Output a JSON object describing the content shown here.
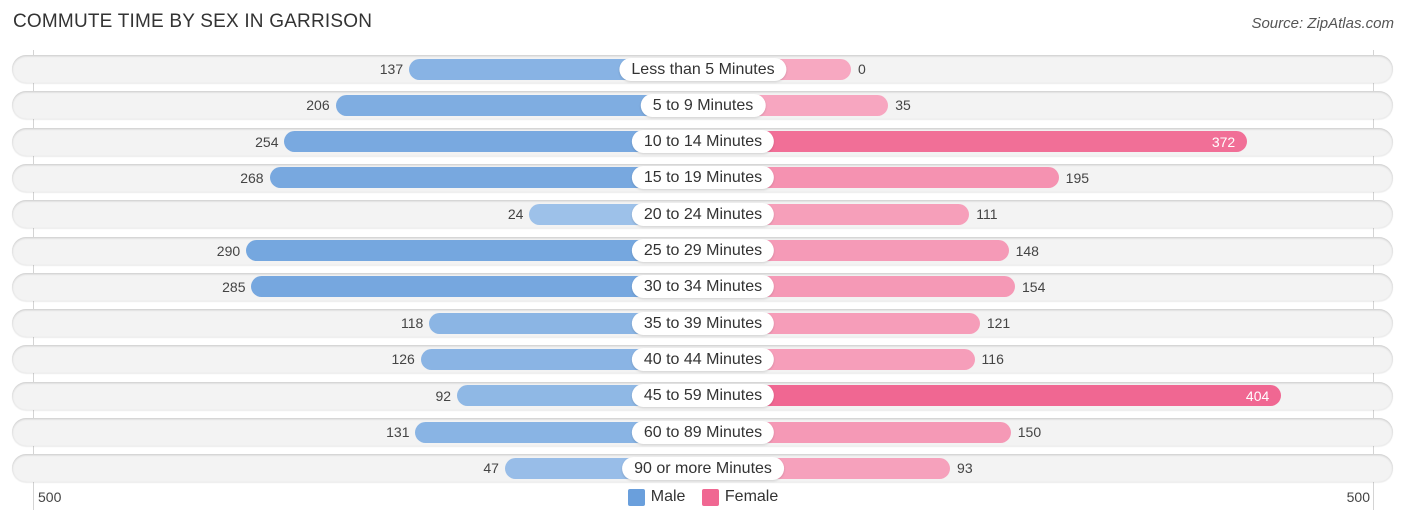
{
  "header": {
    "title": "COMMUTE TIME BY SEX IN GARRISON",
    "source": "Source: ZipAtlas.com"
  },
  "colors": {
    "male": "#6a9fdc",
    "male_light": "#a9c9ec",
    "female": "#f06792",
    "female_light": "#f7a8c1"
  },
  "chart_data": {
    "type": "bar",
    "orientation": "horizontal-diverging",
    "title": "COMMUTE TIME BY SEX IN GARRISON",
    "categories": [
      "Less than 5 Minutes",
      "5 to 9 Minutes",
      "10 to 14 Minutes",
      "15 to 19 Minutes",
      "20 to 24 Minutes",
      "25 to 29 Minutes",
      "30 to 34 Minutes",
      "35 to 39 Minutes",
      "40 to 44 Minutes",
      "45 to 59 Minutes",
      "60 to 89 Minutes",
      "90 or more Minutes"
    ],
    "series": [
      {
        "name": "Male",
        "values": [
          137,
          206,
          254,
          268,
          24,
          290,
          285,
          118,
          126,
          92,
          131,
          47
        ]
      },
      {
        "name": "Female",
        "values": [
          0,
          35,
          372,
          195,
          111,
          148,
          154,
          121,
          116,
          404,
          150,
          93
        ]
      }
    ],
    "axis": {
      "left_label": "500",
      "right_label": "500",
      "xlim": [
        0,
        500
      ]
    },
    "legend": {
      "position": "bottom-center",
      "entries": [
        "Male",
        "Female"
      ]
    },
    "grid": false
  }
}
